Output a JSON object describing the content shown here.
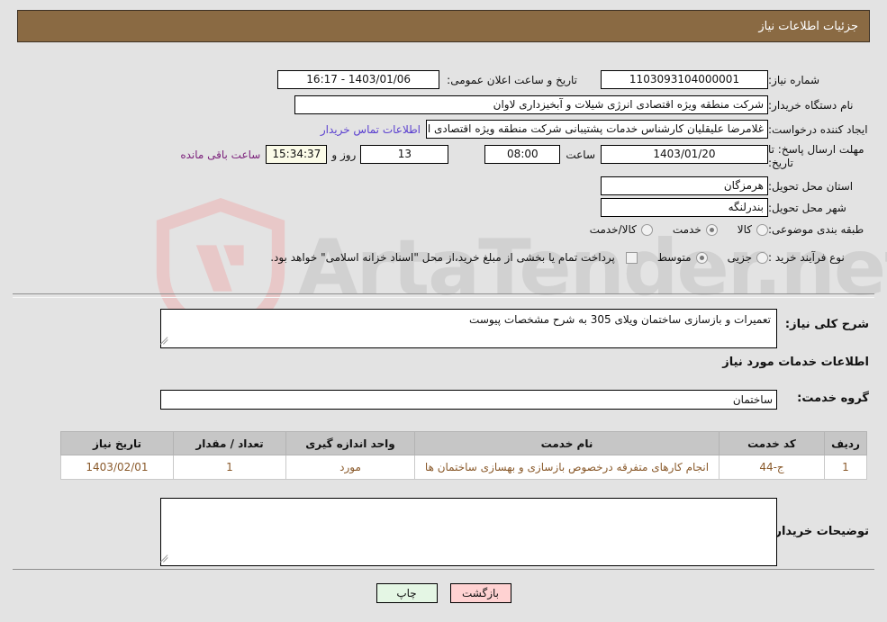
{
  "header": {
    "title": "جزئیات اطلاعات نیاز"
  },
  "colors": {
    "header_bar": "#8a6a43",
    "link": "#5a3fcf",
    "timer_field_bg": "#fbfbe8",
    "back_button": "#ffd2d2",
    "print_button": "#e4f6e4",
    "table_header": "#c6c6c6",
    "table_cell_text": "#8a5a2b",
    "purple_note": "#7a1f7a"
  },
  "fields": {
    "need_number": {
      "label": "شماره نیاز:",
      "value": "1103093104000001"
    },
    "announce_datetime": {
      "label": "تاریخ و ساعت اعلان عمومی:",
      "value": "1403/01/06 - 16:17"
    },
    "buyer_org": {
      "label": "نام دستگاه خریدار:",
      "value": "شرکت منطقه ویژه اقتصادی انرژی شیلات و آبخیزداری لاوان"
    },
    "requester": {
      "label": "ایجاد کننده درخواست:",
      "value": "غلامرضا علیقلیان کارشناس خدمات پشتیبانی شرکت منطقه ویژه اقتصادی انرژی"
    },
    "buyer_contact_link": "اطلاعات تماس خریدار",
    "deadline": {
      "label": "مهلت ارسال پاسخ: تا تاریخ:",
      "date": "1403/01/20",
      "time_label": "ساعت",
      "time": "08:00",
      "days": "13",
      "days_label": "روز و",
      "remaining": "15:34:37",
      "remaining_label": "ساعت باقی مانده"
    },
    "province": {
      "label": "استان محل تحویل:",
      "value": "هرمزگان"
    },
    "city": {
      "label": "شهر محل تحویل:",
      "value": "بندرلنگه"
    },
    "category": {
      "label": "طبقه بندی موضوعی:",
      "options": [
        "کالا",
        "خدمت",
        "کالا/خدمت"
      ],
      "selected": "خدمت"
    },
    "purchase_process": {
      "label": "نوع فرآیند خرید :",
      "options": [
        "جزیی",
        "متوسط"
      ],
      "selected": "متوسط",
      "note_checkbox_checked": false,
      "note": "پرداخت تمام یا بخشی از مبلغ خرید،از محل \"اسناد خزانه اسلامی\" خواهد بود."
    },
    "general_description": {
      "label": "شرح کلی نیاز:",
      "value": "تعمیرات و بازسازی ساختمان ویلای 305 به شرح مشخصات پیوست"
    },
    "service_group": {
      "label": "گروه خدمت:",
      "value": "ساختمان"
    },
    "buyer_notes": {
      "label": "توضیحات خریدار:",
      "value": ""
    }
  },
  "sections": {
    "services_info": "اطلاعات خدمات مورد نیاز"
  },
  "table": {
    "columns": [
      "ردیف",
      "کد خدمت",
      "نام خدمت",
      "واحد اندازه گیری",
      "تعداد / مقدار",
      "تاریخ نیاز"
    ],
    "rows": [
      {
        "index": "1",
        "code": "ج-44",
        "name": "انجام کارهای متفرقه درخصوص بازسازی و بهسازی ساختمان ها",
        "unit": "مورد",
        "quantity": "1",
        "need_date": "1403/02/01"
      }
    ]
  },
  "buttons": {
    "back": "بازگشت",
    "print": "چاپ"
  },
  "watermark": {
    "text": "ArtaTender.net"
  }
}
